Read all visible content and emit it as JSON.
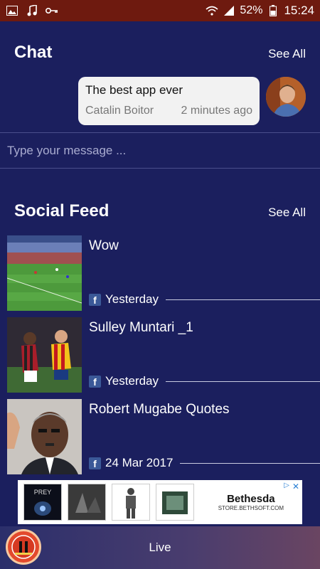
{
  "status_bar": {
    "battery": "52%",
    "time": "15:24",
    "icons": [
      "image-icon",
      "music-icon",
      "key-icon",
      "wifi-icon",
      "signal-icon",
      "battery-icon"
    ]
  },
  "chat": {
    "title": "Chat",
    "see_all": "See All",
    "message": {
      "text": "The best app ever",
      "author": "Catalin Boitor",
      "time": "2 minutes ago"
    },
    "input_placeholder": "Type your message ..."
  },
  "social_feed": {
    "title": "Social Feed",
    "see_all": "See All",
    "items": [
      {
        "title": "Wow",
        "source_icon": "facebook-icon",
        "date": "Yesterday"
      },
      {
        "title": "Sulley  Muntari _1",
        "source_icon": "facebook-icon",
        "date": "Yesterday"
      },
      {
        "title": "Robert Mugabe Quotes",
        "source_icon": "facebook-icon",
        "date": "24 Mar 2017"
      }
    ]
  },
  "ad": {
    "tile1": "PREY",
    "brand": "Bethesda",
    "url": "STORE.BETHSOFT.COM"
  },
  "bottom_bar": {
    "label": "Live"
  },
  "colors": {
    "background": "#1b1f5e",
    "status_bar": "#6e1a0f",
    "facebook": "#3b5998"
  }
}
